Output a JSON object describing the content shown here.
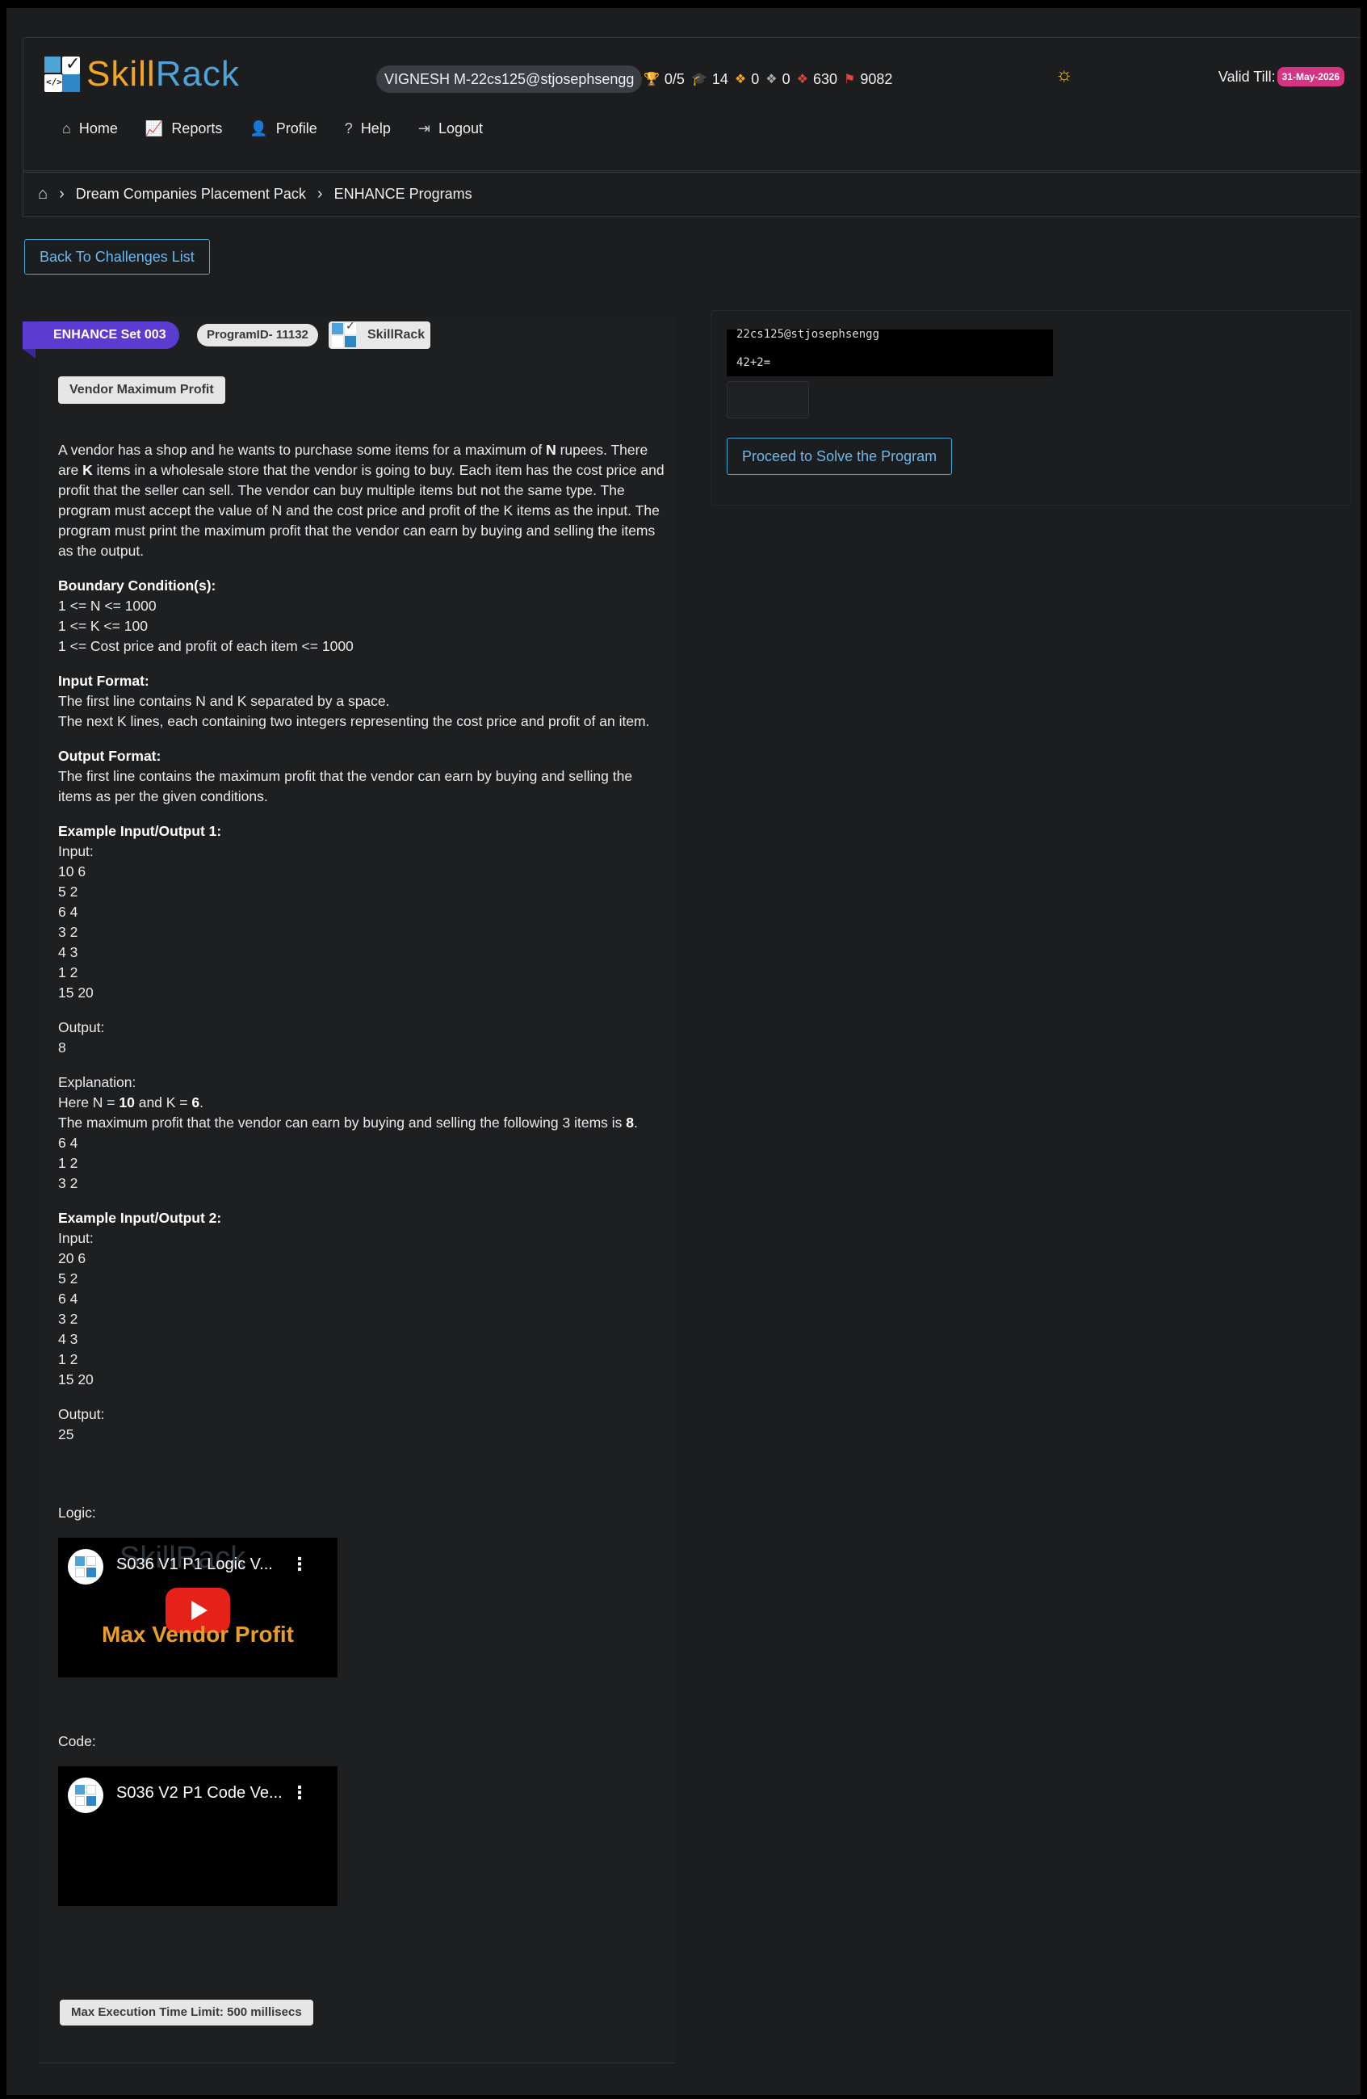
{
  "header": {
    "logo_text_1": "Skill",
    "logo_text_2": "Rack",
    "user": "VIGNESH M-22cs125@stjosephsengg",
    "stats": [
      {
        "icon": "trophy-icon",
        "value": "0/5"
      },
      {
        "icon": "graduation-cap-icon",
        "value": "14"
      },
      {
        "icon": "gold-medal-icon",
        "value": "0"
      },
      {
        "icon": "silver-medal-icon",
        "value": "0"
      },
      {
        "icon": "bronze-medal-icon",
        "value": "630"
      },
      {
        "icon": "flag-icon",
        "value": "9082"
      }
    ],
    "valid_label": "Valid Till:",
    "valid_date": "31-May-2026"
  },
  "nav": [
    {
      "icon": "home-icon",
      "label": "Home"
    },
    {
      "icon": "chart-icon",
      "label": "Reports"
    },
    {
      "icon": "person-icon",
      "label": "Profile"
    },
    {
      "icon": "question-icon",
      "label": "Help"
    },
    {
      "icon": "logout-icon",
      "label": "Logout"
    }
  ],
  "breadcrumb": [
    "Dream Companies Placement Pack",
    "ENHANCE Programs"
  ],
  "back_button": "Back To Challenges List",
  "problem": {
    "set": "ENHANCE Set 003",
    "program_id": "ProgramID- 11132",
    "source": "SkillRack",
    "title": "Vendor Maximum Profit",
    "description": {
      "t1": "A vendor has a shop and he wants to purchase some items for a maximum of ",
      "b1": "N",
      "t2": " rupees. There are ",
      "b2": "K",
      "t3": " items in a wholesale store that the vendor is going to buy. Each item has the cost price and profit that the seller can sell. The vendor can buy multiple items but not the same type. The program must accept the value of N and the cost price and profit of the K items as the input. The program must print the maximum profit that the vendor can earn by buying and selling the items as the output."
    },
    "boundary_title": "Boundary Condition(s):",
    "boundary": [
      "1 <= N <= 1000",
      "1 <= K <= 100",
      "1 <= Cost price and profit of each item <= 1000"
    ],
    "input_title": "Input Format:",
    "input": [
      "The first line contains N and K separated by a space.",
      "The next K lines, each containing two integers representing the cost price and profit of an item."
    ],
    "output_title": "Output Format:",
    "output": "The first line contains the maximum profit that the vendor can earn by buying and selling the items as per the given conditions.",
    "ex1_title": "Example Input/Output 1:",
    "input_label": "Input:",
    "ex1_input": [
      "10 6",
      "5 2",
      "6 4",
      "3 2",
      "4 3",
      "1 2",
      "15 20"
    ],
    "output_label": "Output:",
    "ex1_output": "8",
    "explanation_label": "Explanation:",
    "exp": {
      "t1": "Here N = ",
      "b1": "10",
      "t2": " and K = ",
      "b2": "6",
      "t3": ".",
      "t4": "The maximum profit that the vendor can earn by buying and selling the following 3 items is ",
      "b3": "8",
      "t5": ".",
      "items": [
        "6 4",
        "1 2",
        "3 2"
      ]
    },
    "ex2_title": "Example Input/Output 2:",
    "ex2_input": [
      "20 6",
      "5 2",
      "6 4",
      "3 2",
      "4 3",
      "1 2",
      "15 20"
    ],
    "ex2_output": "25",
    "logic_label": "Logic:",
    "code_label": "Code:",
    "video1": {
      "title": "S036 V1 P1 Logic V...",
      "watermark": "SkillRack",
      "caption": "Max Vendor Profit"
    },
    "video2": {
      "title": "S036 V2 P1 Code Ve..."
    },
    "time_limit": "Max Execution Time Limit: 500 millisecs"
  },
  "right": {
    "captcha_user": "22cs125@stjosephsengg",
    "captcha_question": "42+2=",
    "solve_button": "Proceed to Solve the Program"
  }
}
